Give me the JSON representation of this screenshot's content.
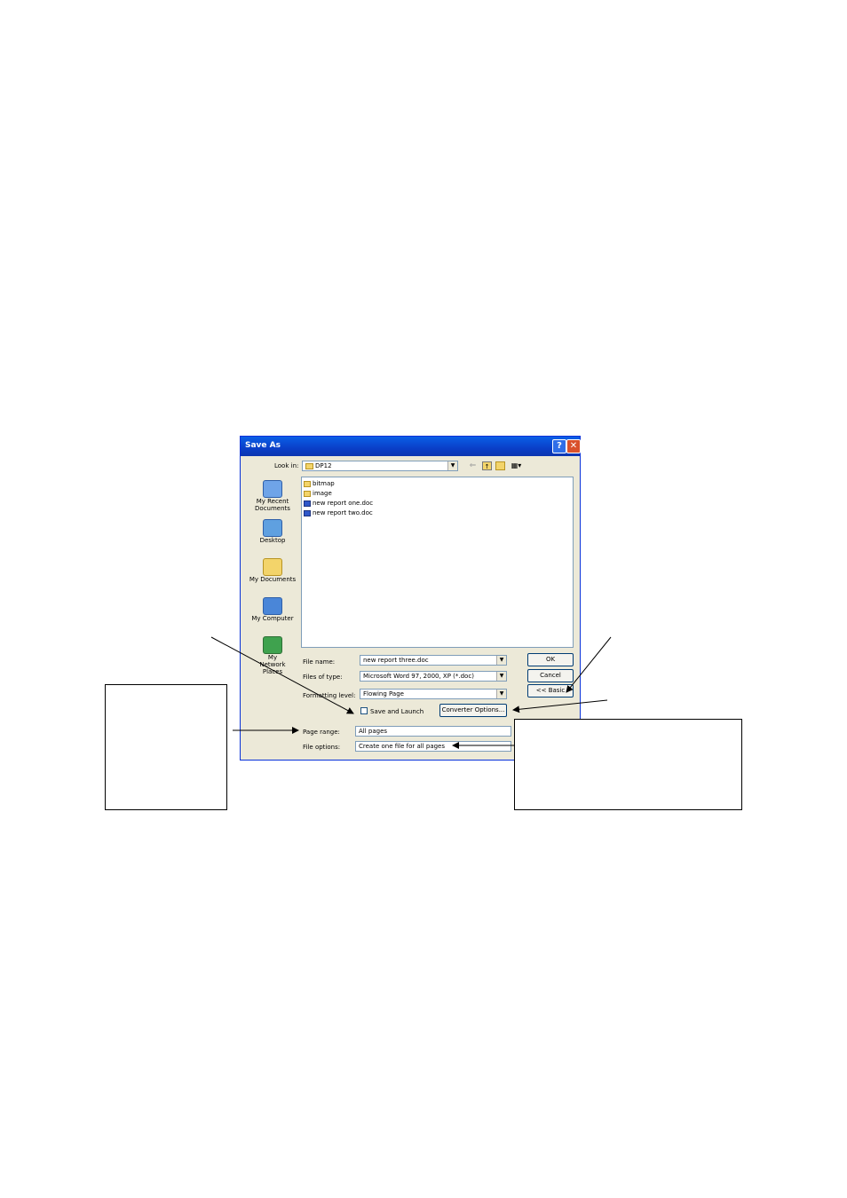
{
  "dialog": {
    "title": "Save As",
    "help_label": "?",
    "close_label": "✕",
    "look_in_label": "Look in:",
    "look_in_value": "DP12",
    "places": [
      {
        "label": "My Recent Documents",
        "icon": "recent-documents-icon"
      },
      {
        "label": "Desktop",
        "icon": "desktop-icon"
      },
      {
        "label": "My Documents",
        "icon": "my-documents-icon"
      },
      {
        "label": "My Computer",
        "icon": "my-computer-icon"
      },
      {
        "label": "My Network Places",
        "icon": "network-places-icon"
      }
    ],
    "files": [
      {
        "name": "bitmap",
        "type": "folder"
      },
      {
        "name": "image",
        "type": "folder"
      },
      {
        "name": "new report one.doc",
        "type": "doc"
      },
      {
        "name": "new report two.doc",
        "type": "doc"
      }
    ],
    "file_name_label": "File name:",
    "file_name_value": "new report three.doc",
    "file_type_label": "Files of type:",
    "file_type_value": "Microsoft Word 97, 2000, XP (*.doc)",
    "formatting_label": "Formatting level:",
    "formatting_value": "Flowing Page",
    "save_launch_label": "Save and Launch",
    "converter_label": "Converter Options...",
    "page_range_label": "Page range:",
    "page_range_value": "All pages",
    "file_options_label": "File options:",
    "file_options_value": "Create one file for all pages",
    "ok_label": "OK",
    "cancel_label": "Cancel",
    "basic_label": "<< Basic"
  }
}
